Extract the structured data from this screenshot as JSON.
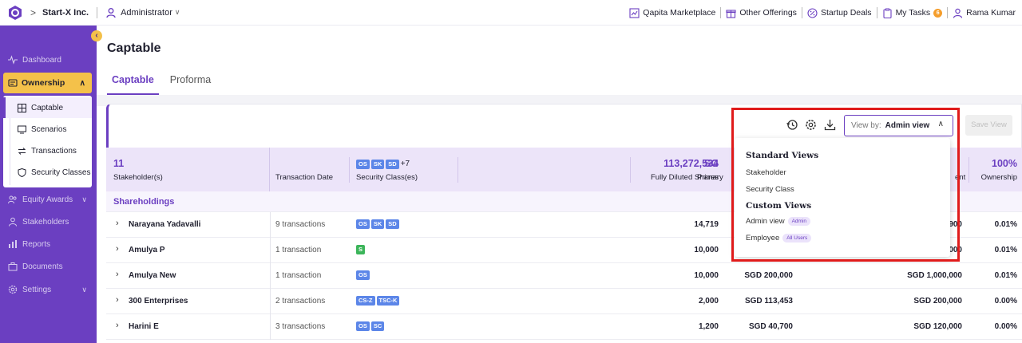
{
  "topbar": {
    "company": "Start-X Inc.",
    "role": "Administrator",
    "links": [
      {
        "label": "Qapita Marketplace",
        "icon": "marketplace-icon"
      },
      {
        "label": "Other Offerings",
        "icon": "gift-icon"
      },
      {
        "label": "Startup Deals",
        "icon": "percent-icon"
      },
      {
        "label": "My Tasks",
        "icon": "clipboard-icon",
        "badge": "6"
      }
    ],
    "user": "Rama Kumar"
  },
  "sidebar": {
    "items": [
      {
        "label": "Dashboard",
        "icon": "pulse-icon"
      },
      {
        "label": "Ownership",
        "icon": "ownership-icon"
      },
      {
        "label": "Equity Awards",
        "icon": "people-icon"
      },
      {
        "label": "Stakeholders",
        "icon": "person-icon"
      },
      {
        "label": "Reports",
        "icon": "chart-icon"
      },
      {
        "label": "Documents",
        "icon": "briefcase-icon"
      },
      {
        "label": "Settings",
        "icon": "settings-icon"
      }
    ],
    "subitems": [
      {
        "label": "Captable",
        "icon": "grid-icon",
        "active": true
      },
      {
        "label": "Scenarios",
        "icon": "monitor-icon"
      },
      {
        "label": "Transactions",
        "icon": "swap-icon"
      },
      {
        "label": "Security Classes",
        "icon": "shield-icon"
      }
    ]
  },
  "main": {
    "title": "Captable",
    "tabs": [
      "Captable",
      "Proforma"
    ],
    "viewby_label": "View by:",
    "viewby_value": "Admin view",
    "save_view": "Save View"
  },
  "table": {
    "stakeholder_count": "11",
    "stakeholder_label": "Stakeholder(s)",
    "transaction_date": "Transaction Date",
    "security_badges": [
      "OS",
      "SK",
      "SD"
    ],
    "security_more": "+7",
    "security_label": "Security Class(es)",
    "fds_total": "113,272,534",
    "fds_label": "Fully Diluted Shares",
    "primary_total": "SG",
    "primary_label": "Primary",
    "invest_label": "ent",
    "own_total": "100%",
    "own_label": "Ownership",
    "section": "Shareholdings",
    "rows": [
      {
        "name": "Narayana Yadavalli",
        "tx": "9 transactions",
        "badges": [
          "OS",
          "SK",
          "SD"
        ],
        "fds": "14,719",
        "primary": "",
        "invest": "900",
        "own": "0.01%"
      },
      {
        "name": "Amulya P",
        "tx": "1 transaction",
        "badges": [
          "S"
        ],
        "fds": "10,000",
        "primary": "",
        "invest": "000",
        "own": "0.01%"
      },
      {
        "name": "Amulya New",
        "tx": "1 transaction",
        "badges": [
          "OS"
        ],
        "fds": "10,000",
        "primary": "SGD 200,000",
        "invest": "SGD 1,000,000",
        "own": "0.01%"
      },
      {
        "name": "300 Enterprises",
        "tx": "2 transactions",
        "badges": [
          "CS-Z",
          "TSC-K"
        ],
        "fds": "2,000",
        "primary": "SGD 113,453",
        "invest": "SGD 200,000",
        "own": "0.00%"
      },
      {
        "name": "Harini E",
        "tx": "3 transactions",
        "badges": [
          "OS",
          "SC"
        ],
        "fds": "1,200",
        "primary": "SGD 40,700",
        "invest": "SGD 120,000",
        "own": "0.00%"
      }
    ]
  },
  "dropdown": {
    "standard_heading": "Standard Views",
    "standard": [
      "Stakeholder",
      "Security Class"
    ],
    "custom_heading": "Custom Views",
    "custom": [
      {
        "label": "Admin view",
        "pill": "Admin"
      },
      {
        "label": "Employee",
        "pill": "All Users"
      }
    ]
  },
  "colors": {
    "brand": "#6b3fc1",
    "accent": "#f4c14a",
    "highlight": "#e01b1b"
  }
}
